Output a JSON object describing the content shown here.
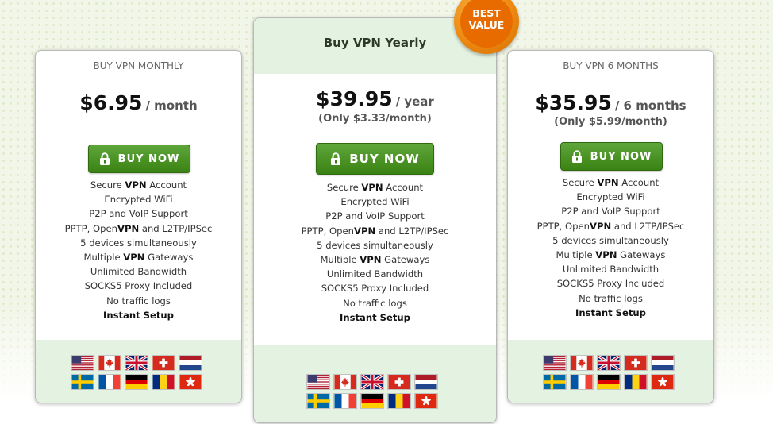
{
  "colors": {
    "button_green": "#4a9526",
    "panel_green": "#e4f2e1",
    "badge_orange": "#ee8a10"
  },
  "badge": {
    "line1": "BEST",
    "line2": "VALUE"
  },
  "plans": [
    {
      "name": "BUY VPN MONTHLY",
      "price": "$6.95",
      "period": "/ month",
      "sub": "",
      "buy_label": "BUY NOW",
      "features": [
        "Secure VPN Account",
        "Encrypted WiFi",
        "P2P and VoIP Support",
        "PPTP, OpenVPN and L2TP/IPSec",
        "5 devices simultaneously",
        "Multiple VPN Gateways",
        "Unlimited Bandwidth",
        "SOCKS5 Proxy Included",
        "No traffic logs",
        "Instant Setup"
      ]
    },
    {
      "name": "Buy VPN Yearly",
      "price": "$39.95",
      "period": "/ year",
      "sub": "(Only $3.33/month)",
      "buy_label": "BUY NOW",
      "features": [
        "Secure VPN Account",
        "Encrypted WiFi",
        "P2P and VoIP Support",
        "PPTP, OpenVPN and L2TP/IPSec",
        "5 devices simultaneously",
        "Multiple VPN Gateways",
        "Unlimited Bandwidth",
        "SOCKS5 Proxy Included",
        "No traffic logs",
        "Instant Setup"
      ]
    },
    {
      "name": "BUY VPN 6 MONTHS",
      "price": "$35.95",
      "period": "/ 6 months",
      "sub": "(Only $5.99/month)",
      "buy_label": "BUY NOW",
      "features": [
        "Secure VPN Account",
        "Encrypted WiFi",
        "P2P and VoIP Support",
        "PPTP, OpenVPN and L2TP/IPSec",
        "5 devices simultaneously",
        "Multiple VPN Gateways",
        "Unlimited Bandwidth",
        "SOCKS5 Proxy Included",
        "No traffic logs",
        "Instant Setup"
      ]
    }
  ],
  "flags": [
    "us-flag-icon",
    "canada-flag-icon",
    "uk-flag-icon",
    "switzerland-flag-icon",
    "netherlands-flag-icon",
    "sweden-flag-icon",
    "france-flag-icon",
    "germany-flag-icon",
    "romania-flag-icon",
    "hong-kong-flag-icon"
  ]
}
